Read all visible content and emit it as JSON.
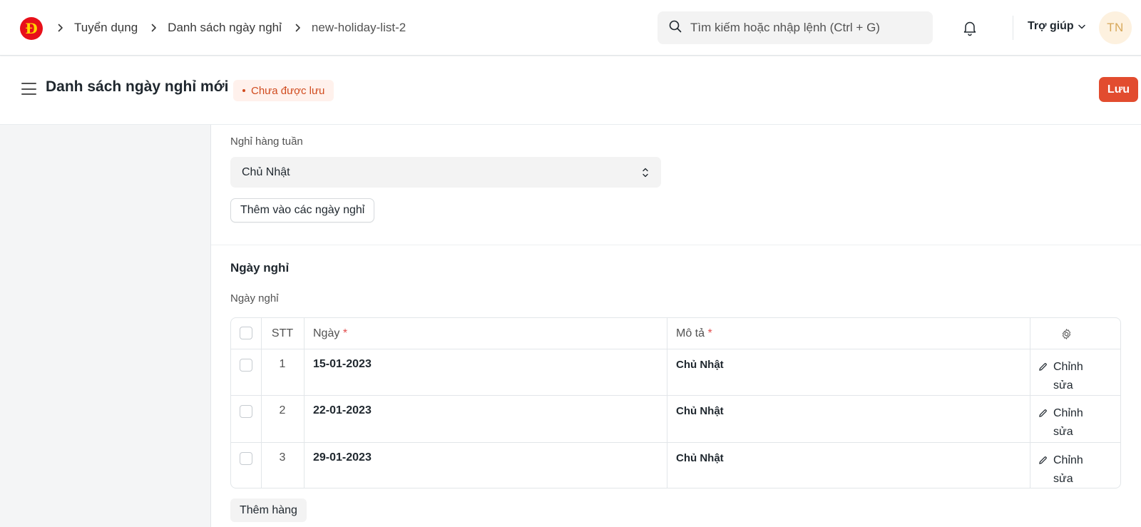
{
  "navbar": {
    "logo_text": "Đ",
    "breadcrumbs": [
      "Tuyển dụng",
      "Danh sách ngày nghỉ",
      "new-holiday-list-2"
    ],
    "search_placeholder": "Tìm kiếm hoặc nhập lệnh (Ctrl + G)",
    "help_label": "Trợ giúp",
    "avatar_initials": "TN"
  },
  "page": {
    "title": "Danh sách ngày nghỉ mới",
    "status": "Chưa được lưu",
    "save_label": "Lưu"
  },
  "form": {
    "weekly_off_label": "Nghỉ hàng tuần",
    "weekly_off_value": "Chủ Nhật",
    "add_holidays_label": "Thêm vào các ngày nghỉ",
    "section_title": "Ngày nghỉ",
    "table_label": "Ngày nghỉ",
    "columns": {
      "index": "STT",
      "date": "Ngày",
      "description": "Mô tả",
      "required_mark": "*"
    },
    "rows": [
      {
        "index": "1",
        "date": "15-01-2023",
        "description": "Chủ Nhật",
        "edit_line1": "Chỉnh",
        "edit_line2": "sửa"
      },
      {
        "index": "2",
        "date": "22-01-2023",
        "description": "Chủ Nhật",
        "edit_line1": "Chỉnh",
        "edit_line2": "sửa"
      },
      {
        "index": "3",
        "date": "29-01-2023",
        "description": "Chủ Nhật",
        "edit_line1": "Chỉnh",
        "edit_line2": "sửa"
      }
    ],
    "add_row_label": "Thêm hàng"
  },
  "colors": {
    "primary": "#e24c2f",
    "logo_red": "#e8101a",
    "logo_yellow": "#ffd400",
    "badge_bg": "#fff1ec",
    "badge_text": "#d04b1e"
  },
  "icons": [
    "search-icon",
    "bell-icon",
    "chevron-down-icon",
    "chevron-right-icon",
    "hamburger-icon",
    "sort-arrows-icon",
    "gear-icon",
    "pencil-icon"
  ]
}
